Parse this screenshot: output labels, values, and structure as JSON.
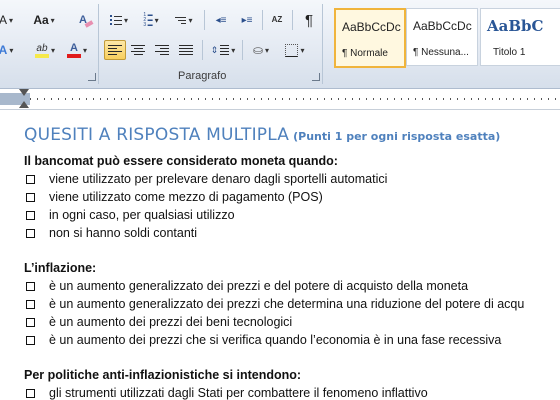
{
  "font_group": {
    "grow_font_label": "A",
    "change_case_label": "Aa",
    "highlight_label": "ab",
    "font_color_label": "A",
    "clear_format_label": "A",
    "text_effects_label": "A",
    "accent_colors": {
      "highlight": "#f6e94b",
      "font_color": "#e01b1b"
    }
  },
  "paragraph_group": {
    "label": "Paragrafo",
    "pilcrow": "¶",
    "sort_label": "AZ",
    "active_alignment": "align-left"
  },
  "styles_gallery": {
    "items": [
      {
        "sample": "AaBbCcDc",
        "name": "¶ Normale",
        "selected": true
      },
      {
        "sample": "AaBbCcDc",
        "name": "¶ Nessuna...",
        "selected": false
      },
      {
        "sample": "AaBbC",
        "name": "Titolo 1",
        "selected": false
      }
    ]
  },
  "document": {
    "title": "QUESITI A RISPOSTA MULTIPLA",
    "subtitle": "(Punti 1 per ogni risposta esatta)",
    "questions": [
      {
        "text": "Il bancomat può essere considerato moneta quando:",
        "options": [
          "viene utilizzato per prelevare denaro dagli sportelli automatici",
          "viene utilizzato come mezzo di pagamento (POS)",
          "in ogni caso, per qualsiasi utilizzo",
          "non si hanno soldi contanti"
        ]
      },
      {
        "text": "L’inflazione:",
        "options": [
          "è un aumento generalizzato dei prezzi e del potere di acquisto della moneta",
          "è un aumento generalizzato dei prezzi che determina una riduzione del potere di acqu",
          "è un aumento dei prezzi dei beni tecnologici",
          "è un aumento dei prezzi che si verifica quando l’economia è in una fase recessiva"
        ]
      },
      {
        "text": "Per politiche anti-inflazionistiche si intendono:",
        "options": [
          "gli strumenti utilizzati dagli Stati per combattere il fenomeno inflattivo"
        ]
      }
    ]
  }
}
